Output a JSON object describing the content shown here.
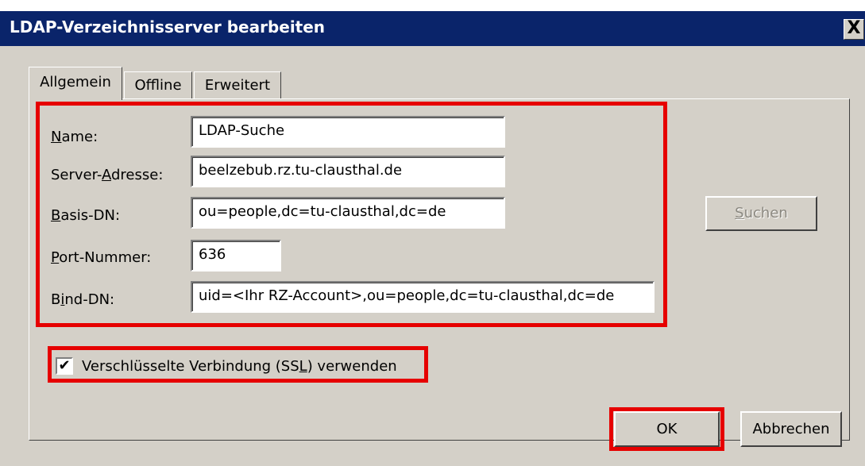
{
  "window": {
    "title": "LDAP-Verzeichnisserver bearbeiten",
    "close_label": "X"
  },
  "tabs": [
    {
      "label": "Allgemein",
      "active": true
    },
    {
      "label": "Offline",
      "active": false
    },
    {
      "label": "Erweitert",
      "active": false
    }
  ],
  "form": {
    "name": {
      "label_pre": "",
      "label_key": "N",
      "label_post": "ame:",
      "value": "LDAP-Suche"
    },
    "server": {
      "label_pre": "Server-",
      "label_key": "A",
      "label_post": "dresse:",
      "value": "beelzebub.rz.tu-clausthal.de"
    },
    "basedn": {
      "label_pre": "",
      "label_key": "B",
      "label_post": "asis-DN:",
      "value": "ou=people,dc=tu-clausthal,dc=de"
    },
    "port": {
      "label_pre": "",
      "label_key": "P",
      "label_post": "ort-Nummer:",
      "value": "636"
    },
    "binddn": {
      "label_pre": "B",
      "label_key": "i",
      "label_post": "nd-DN:",
      "value": "uid=<Ihr RZ-Account>,ou=people,dc=tu-clausthal,dc=de"
    }
  },
  "ssl": {
    "checked": true,
    "check_glyph": "✔",
    "label_pre": "Verschlüsselte Verbindung (SS",
    "label_key": "L",
    "label_post": ") verwenden"
  },
  "buttons": {
    "search": {
      "label_key": "S",
      "label_post": "uchen",
      "enabled": false
    },
    "ok": "OK",
    "cancel": "Abbrechen"
  },
  "highlight_color": "#e60000"
}
